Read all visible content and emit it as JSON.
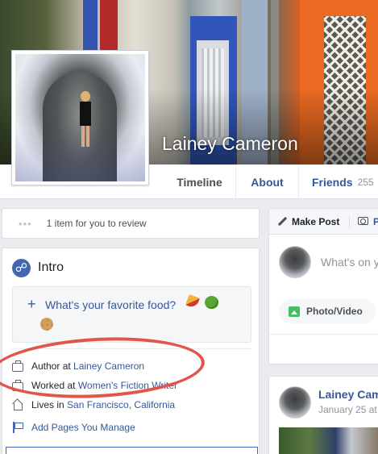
{
  "profile": {
    "name": "Lainey Cameron"
  },
  "nav": {
    "tabs": [
      {
        "label": "Timeline"
      },
      {
        "label": "About"
      },
      {
        "label": "Friends",
        "count": "255"
      }
    ]
  },
  "review": {
    "dots": "•••",
    "text": "1 item for you to review"
  },
  "intro": {
    "title": "Intro",
    "icon": "globe-icon",
    "favorite_prompt": {
      "plus": "+",
      "text": "What's your favorite food?"
    },
    "rows": {
      "author": {
        "prefix": "Author at ",
        "link": "Lainey Cameron"
      },
      "worked": {
        "prefix": "Worked at ",
        "link": "Women's Fiction Writer"
      },
      "lives": {
        "prefix": "Lives in ",
        "link": "San Francisco, California"
      },
      "pages": {
        "text": "Add Pages You Manage"
      }
    }
  },
  "composer": {
    "make_post": "Make Post",
    "photo_tab_partial": "P",
    "placeholder": "What's on y",
    "photo_video": "Photo/Video"
  },
  "post": {
    "author": "Lainey Cam",
    "date": "January 25 at"
  },
  "colors": {
    "link": "#365899",
    "annotation_ellipse": "#e0564a",
    "facebook_blue": "#4267b2"
  }
}
